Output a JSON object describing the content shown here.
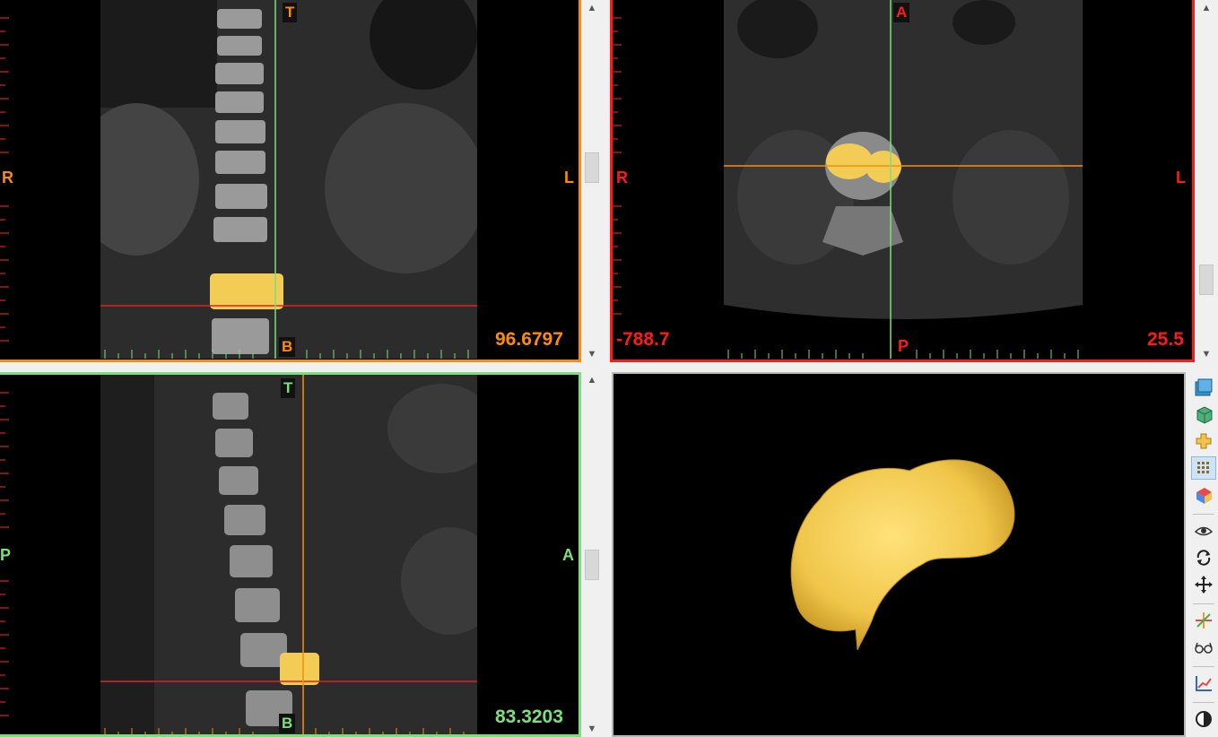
{
  "views": {
    "coronal": {
      "top": "T",
      "bottom": "B",
      "left": "R",
      "right": "L",
      "value": "96.6797"
    },
    "axial": {
      "top": "A",
      "bottom": "P",
      "left": "R",
      "right": "L",
      "value_left": "-788.7",
      "value_right": "25.5"
    },
    "sagittal": {
      "top": "T",
      "bottom": "B",
      "left": "P",
      "right": "A",
      "value": "83.3203"
    }
  },
  "scrollbars": {
    "up": "▲",
    "down": "▼"
  },
  "colors": {
    "coronal": "#ff8c00",
    "axial": "#ff1a1a",
    "sagittal": "#7ae07a",
    "segmentation": "#f2cc55"
  },
  "toolbar": {
    "icons": [
      "layers-icon",
      "cube-icon",
      "crosshair-cube-icon",
      "grid-icon",
      "color-cube-icon",
      "eye-icon",
      "rotate-icon",
      "move-icon",
      "axes-icon",
      "glasses-icon",
      "chart-icon",
      "contrast-icon"
    ],
    "active": "grid-icon"
  }
}
